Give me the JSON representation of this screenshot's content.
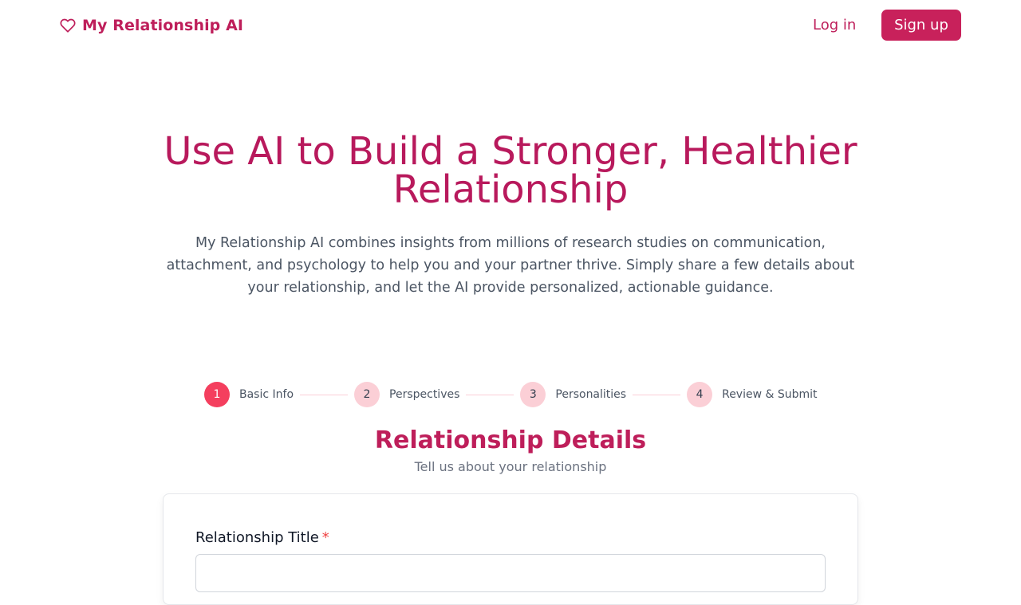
{
  "header": {
    "brand_name": "My Relationship AI",
    "brand_icon": "heart-icon",
    "login_label": "Log in",
    "signup_label": "Sign up"
  },
  "hero": {
    "title": "Use AI to Build a Stronger, Healthier Relationship",
    "description": "My Relationship AI combines insights from millions of research studies on communication, attachment, and psychology to help you and your partner thrive. Simply share a few details about your relationship, and let the AI provide personalized, actionable guidance."
  },
  "stepper": {
    "steps": [
      {
        "number": "1",
        "label": "Basic Info",
        "active": true
      },
      {
        "number": "2",
        "label": "Perspectives",
        "active": false
      },
      {
        "number": "3",
        "label": "Personalities",
        "active": false
      },
      {
        "number": "4",
        "label": "Review & Submit",
        "active": false
      }
    ]
  },
  "section": {
    "title": "Relationship Details",
    "subtitle": "Tell us about your relationship"
  },
  "form": {
    "title_label": "Relationship Title",
    "required_mark": "*",
    "title_value": ""
  },
  "colors": {
    "brand": "#be1e5a",
    "accent_active": "#f43f5e",
    "step_inactive": "#fbcfd6",
    "button_bg": "#c8215b"
  }
}
